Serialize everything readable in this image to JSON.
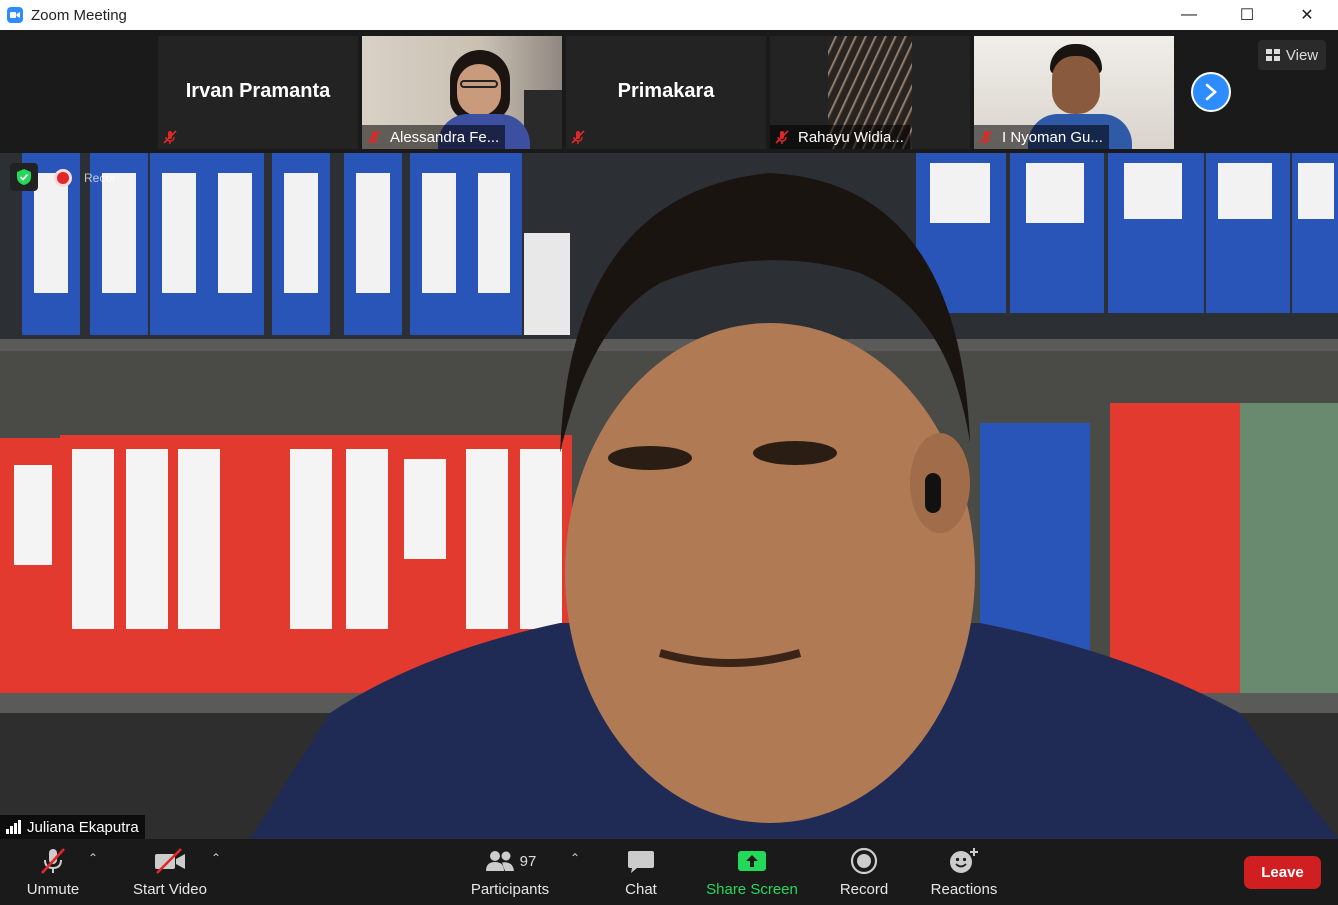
{
  "window": {
    "title": "Zoom Meeting",
    "minimize": "—",
    "maximize": "☐",
    "close": "✕"
  },
  "gallery": {
    "tiles": [
      {
        "name": "Irvan Pramanta",
        "label": ""
      },
      {
        "name": "",
        "label": "Alessandra Fe..."
      },
      {
        "name": "Primakara",
        "label": ""
      },
      {
        "name": "",
        "label": "Rahayu Widia..."
      },
      {
        "name": "",
        "label": "I Nyoman Gu..."
      }
    ],
    "view_label": "View"
  },
  "main": {
    "speaker": "Juliana Ekaputra",
    "recording_text": "Recor"
  },
  "toolbar": {
    "unmute": "Unmute",
    "start_video": "Start Video",
    "participants": "Participants",
    "participants_count": "97",
    "chat": "Chat",
    "share_screen": "Share Screen",
    "record": "Record",
    "reactions": "Reactions",
    "leave": "Leave"
  },
  "colors": {
    "accent": "#2d8cff",
    "share": "#23d959",
    "leave": "#d11f21",
    "mute": "#e02828"
  }
}
